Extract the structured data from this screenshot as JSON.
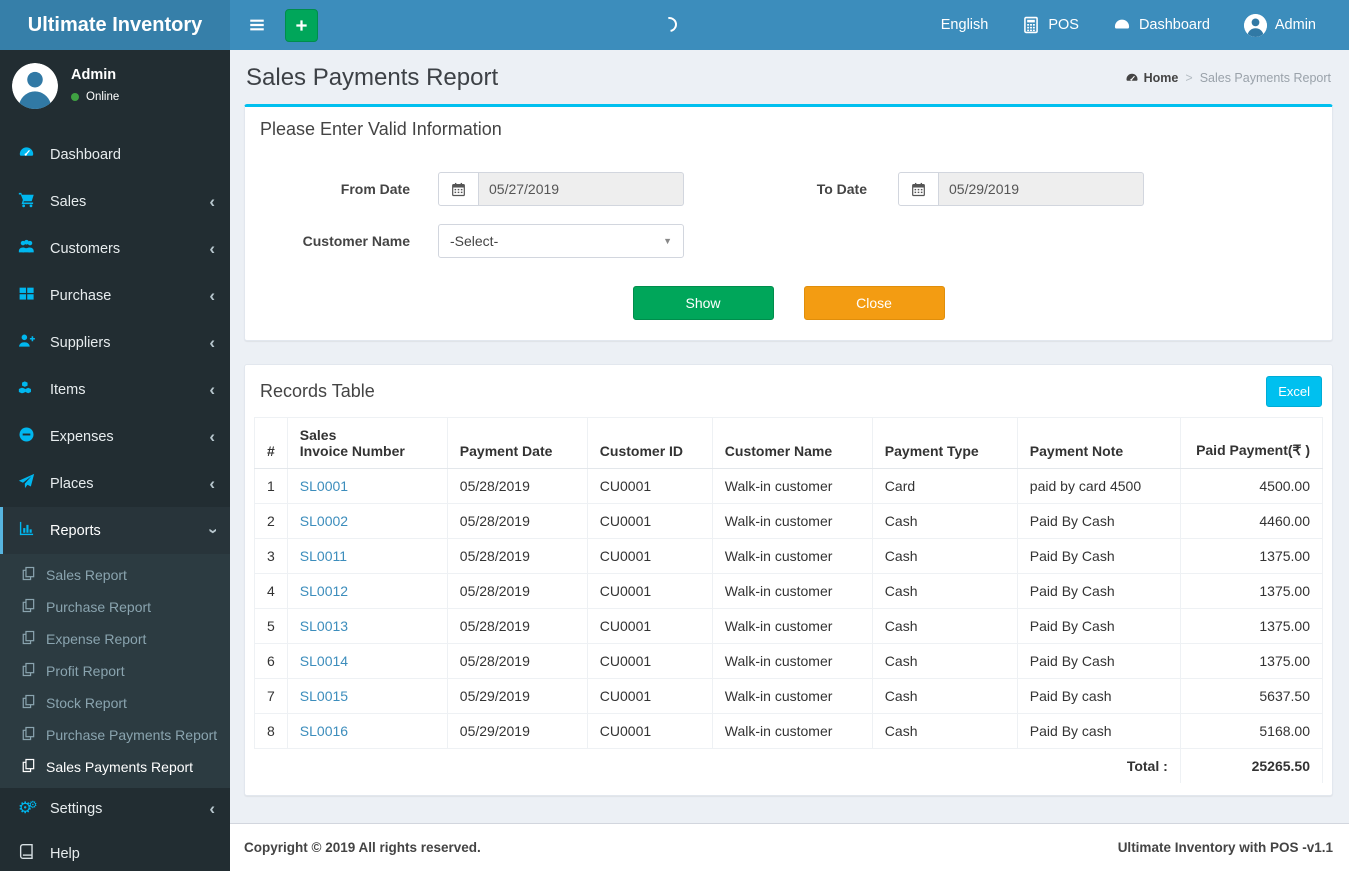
{
  "brand": "Ultimate Inventory",
  "colors": {
    "accent": "#3c8dbc",
    "logo-bg": "#367fa9",
    "info": "#00c0ef",
    "success": "#00a65a",
    "warning": "#f39c12",
    "link": "#3c8dbc",
    "sidebar-bg": "#222d32",
    "submenu-bg": "#2c3b41",
    "icon-cyan": "#00b7ef",
    "active-stripe": "#57b5e0",
    "online-green": "#3fa142"
  },
  "navbar": {
    "hamburger_icon": "hamburger",
    "add_button_icon": "plus",
    "spinner_icon": "spinner",
    "items": [
      {
        "label": "English",
        "icon": ""
      },
      {
        "label": "POS",
        "icon": "calculator"
      },
      {
        "label": "Dashboard",
        "icon": "gauge"
      },
      {
        "label": "Admin",
        "icon": "avatar"
      }
    ]
  },
  "sidebar": {
    "user_name": "Admin",
    "user_status": "Online",
    "items": [
      {
        "label": "Dashboard",
        "icon": "gauge",
        "chevron": ""
      },
      {
        "label": "Sales",
        "icon": "cart",
        "chevron": "left"
      },
      {
        "label": "Customers",
        "icon": "users",
        "chevron": "left"
      },
      {
        "label": "Purchase",
        "icon": "grid",
        "chevron": "left"
      },
      {
        "label": "Suppliers",
        "icon": "user-plus",
        "chevron": "left"
      },
      {
        "label": "Items",
        "icon": "cubes",
        "chevron": "left"
      },
      {
        "label": "Expenses",
        "icon": "minus-circle",
        "chevron": "left"
      },
      {
        "label": "Places",
        "icon": "paper-plane",
        "chevron": "left"
      },
      {
        "label": "Reports",
        "icon": "bar-chart",
        "chevron": "down",
        "active": true,
        "submenu": [
          {
            "label": "Sales Report",
            "icon": "copy"
          },
          {
            "label": "Purchase Report",
            "icon": "copy"
          },
          {
            "label": "Expense Report",
            "icon": "copy"
          },
          {
            "label": "Profit Report",
            "icon": "copy"
          },
          {
            "label": "Stock Report",
            "icon": "copy"
          },
          {
            "label": "Purchase Payments Report",
            "icon": "copy"
          },
          {
            "label": "Sales Payments Report",
            "icon": "copy",
            "active": true
          }
        ]
      },
      {
        "label": "Settings",
        "icon": "gears",
        "chevron": "left"
      },
      {
        "label": "Help",
        "icon": "book",
        "chevron": "",
        "plain": true
      }
    ]
  },
  "page": {
    "title": "Sales Payments Report",
    "breadcrumb": {
      "home_icon": "gauge",
      "home_label": "Home",
      "separator": ">",
      "current": "Sales Payments Report"
    }
  },
  "filter": {
    "heading": "Please Enter Valid Information",
    "from_label": "From Date",
    "from_value": "05/27/2019",
    "to_label": "To Date",
    "to_value": "05/29/2019",
    "calendar_icon": "calendar",
    "customer_label": "Customer Name",
    "customer_value": "-Select-",
    "caret_icon": "caret-down",
    "show_label": "Show",
    "close_label": "Close"
  },
  "records": {
    "heading": "Records Table",
    "excel_label": "Excel",
    "columns": [
      "#",
      "Sales\nInvoice Number",
      "Payment Date",
      "Customer ID",
      "Customer Name",
      "Payment Type",
      "Payment Note",
      "Paid Payment(₹ )"
    ],
    "rows": [
      {
        "n": "1",
        "invoice": "SL0001",
        "date": "05/28/2019",
        "cust_id": "CU0001",
        "cust_name": "Walk-in customer",
        "type": "Card",
        "note": "paid by card 4500",
        "amount": "4500.00"
      },
      {
        "n": "2",
        "invoice": "SL0002",
        "date": "05/28/2019",
        "cust_id": "CU0001",
        "cust_name": "Walk-in customer",
        "type": "Cash",
        "note": "Paid By Cash",
        "amount": "4460.00"
      },
      {
        "n": "3",
        "invoice": "SL0011",
        "date": "05/28/2019",
        "cust_id": "CU0001",
        "cust_name": "Walk-in customer",
        "type": "Cash",
        "note": "Paid By Cash",
        "amount": "1375.00"
      },
      {
        "n": "4",
        "invoice": "SL0012",
        "date": "05/28/2019",
        "cust_id": "CU0001",
        "cust_name": "Walk-in customer",
        "type": "Cash",
        "note": "Paid By Cash",
        "amount": "1375.00"
      },
      {
        "n": "5",
        "invoice": "SL0013",
        "date": "05/28/2019",
        "cust_id": "CU0001",
        "cust_name": "Walk-in customer",
        "type": "Cash",
        "note": "Paid By Cash",
        "amount": "1375.00"
      },
      {
        "n": "6",
        "invoice": "SL0014",
        "date": "05/28/2019",
        "cust_id": "CU0001",
        "cust_name": "Walk-in customer",
        "type": "Cash",
        "note": "Paid By Cash",
        "amount": "1375.00"
      },
      {
        "n": "7",
        "invoice": "SL0015",
        "date": "05/29/2019",
        "cust_id": "CU0001",
        "cust_name": "Walk-in customer",
        "type": "Cash",
        "note": "Paid By cash",
        "amount": "5637.50"
      },
      {
        "n": "8",
        "invoice": "SL0016",
        "date": "05/29/2019",
        "cust_id": "CU0001",
        "cust_name": "Walk-in customer",
        "type": "Cash",
        "note": "Paid By cash",
        "amount": "5168.00"
      }
    ],
    "total_label": "Total :",
    "total_value": "25265.50"
  },
  "footer": {
    "left": "Copyright © 2019 All rights reserved.",
    "right": "Ultimate Inventory with POS -v1.1"
  }
}
